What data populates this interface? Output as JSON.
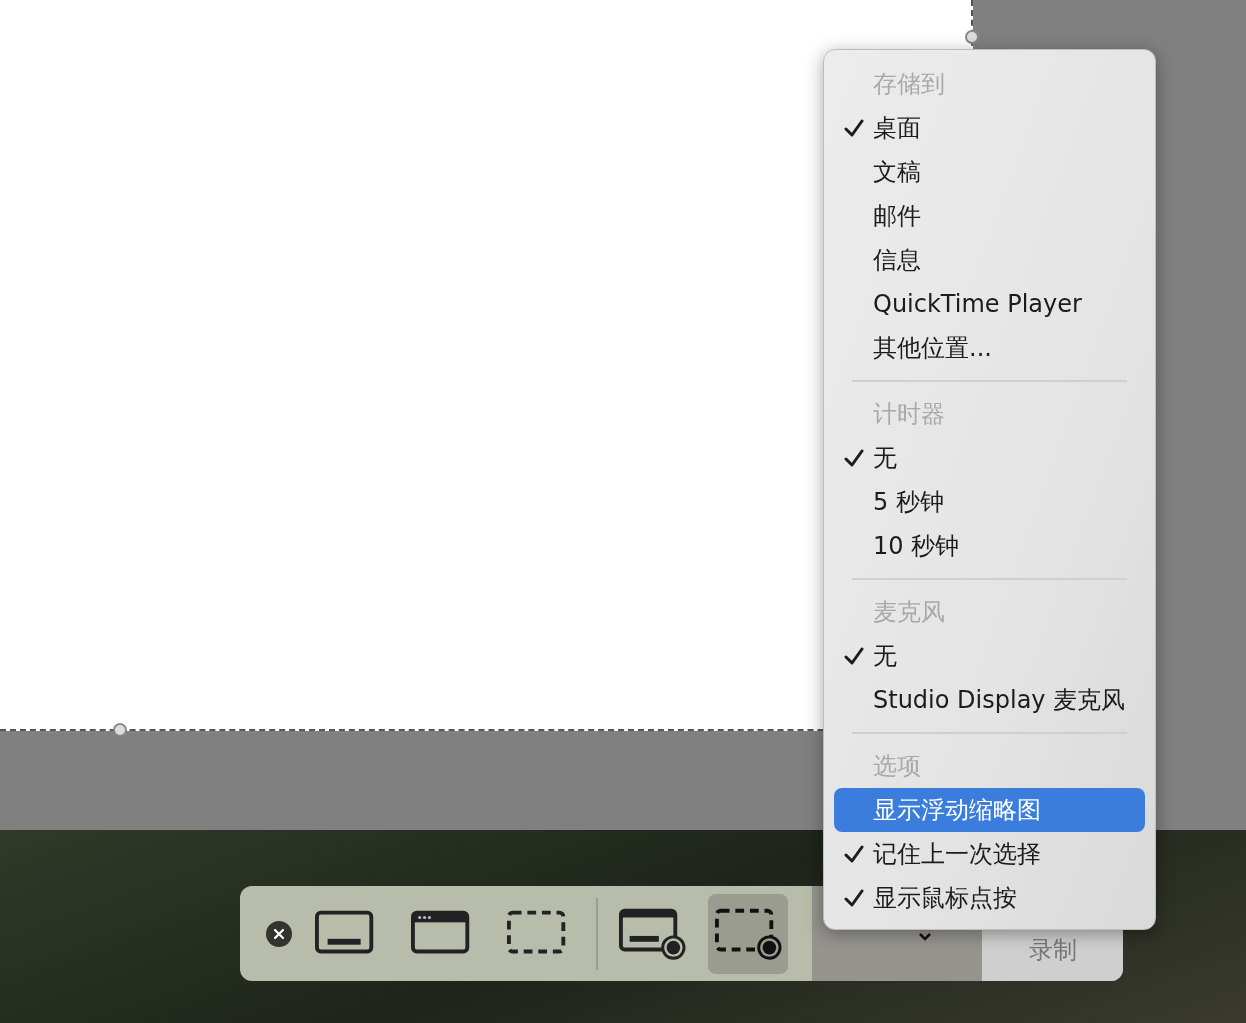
{
  "toolbar": {
    "modes": [
      {
        "kind": "capture-screen",
        "selected": false
      },
      {
        "kind": "capture-window",
        "selected": false
      },
      {
        "kind": "capture-selection",
        "selected": false
      },
      {
        "kind": "record-screen",
        "selected": false
      },
      {
        "kind": "record-selection",
        "selected": true
      }
    ],
    "record_button": {
      "label": "录制"
    }
  },
  "menu": {
    "sections": [
      {
        "heading": "存储到",
        "items": [
          {
            "label": "桌面",
            "checked": true,
            "selected": false
          },
          {
            "label": "文稿",
            "checked": false,
            "selected": false
          },
          {
            "label": "邮件",
            "checked": false,
            "selected": false
          },
          {
            "label": "信息",
            "checked": false,
            "selected": false
          },
          {
            "label": "QuickTime Player",
            "checked": false,
            "selected": false
          },
          {
            "label": "其他位置...",
            "checked": false,
            "selected": false
          }
        ]
      },
      {
        "heading": "计时器",
        "items": [
          {
            "label": "无",
            "checked": true,
            "selected": false
          },
          {
            "label": "5 秒钟",
            "checked": false,
            "selected": false
          },
          {
            "label": "10 秒钟",
            "checked": false,
            "selected": false
          }
        ]
      },
      {
        "heading": "麦克风",
        "items": [
          {
            "label": "无",
            "checked": true,
            "selected": false
          },
          {
            "label": "Studio Display 麦克风",
            "checked": false,
            "selected": false
          }
        ]
      },
      {
        "heading": "选项",
        "items": [
          {
            "label": "显示浮动缩略图",
            "checked": false,
            "selected": true
          },
          {
            "label": "记住上一次选择",
            "checked": true,
            "selected": false
          },
          {
            "label": "显示鼠标点按",
            "checked": true,
            "selected": false
          }
        ]
      }
    ]
  }
}
